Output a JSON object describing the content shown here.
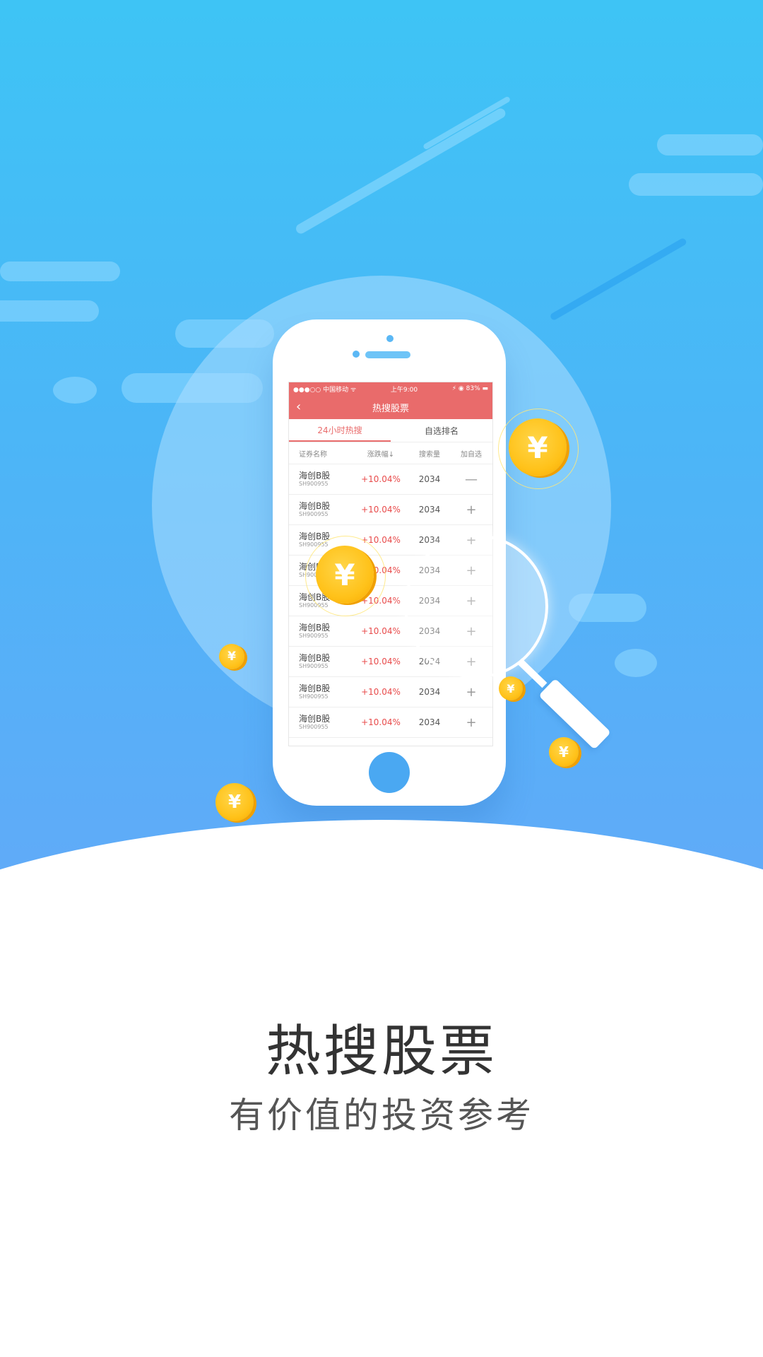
{
  "colors": {
    "accent": "#e96b6b",
    "hero_top": "#3ec4f5",
    "hero_bottom": "#63a9f8",
    "coin": "#ffc21a"
  },
  "phone": {
    "status_bar": {
      "carrier": "●●●○○ 中国移动 ᯤ",
      "time": "上午9:00",
      "battery": "⚡ ◉ 83% ▬"
    },
    "nav": {
      "back_icon": "‹",
      "title": "热搜股票"
    },
    "tabs": [
      {
        "label": "24小时热搜",
        "active": true
      },
      {
        "label": "自选排名",
        "active": false
      }
    ],
    "table": {
      "headers": [
        "证券名称",
        "涨跌幅↓",
        "搜索量",
        "加自选"
      ],
      "rows": [
        {
          "name": "海创B股",
          "code": "SH900955",
          "change": "+10.04%",
          "volume": "2034",
          "action": "—"
        },
        {
          "name": "海创B股",
          "code": "SH900955",
          "change": "+10.04%",
          "volume": "2034",
          "action": "+"
        },
        {
          "name": "海创B股",
          "code": "SH900955",
          "change": "+10.04%",
          "volume": "2034",
          "action": "+"
        },
        {
          "name": "海创B股",
          "code": "SH900955",
          "change": "+10.04%",
          "volume": "2034",
          "action": "+"
        },
        {
          "name": "海创B股",
          "code": "SH900955",
          "change": "+10.04%",
          "volume": "2034",
          "action": "+"
        },
        {
          "name": "海创B股",
          "code": "SH900955",
          "change": "+10.04%",
          "volume": "2034",
          "action": "+"
        },
        {
          "name": "海创B股",
          "code": "SH900955",
          "change": "+10.04%",
          "volume": "2034",
          "action": "+"
        },
        {
          "name": "海创B股",
          "code": "SH900955",
          "change": "+10.04%",
          "volume": "2034",
          "action": "+"
        },
        {
          "name": "海创B股",
          "code": "SH900955",
          "change": "+10.04%",
          "volume": "2034",
          "action": "+"
        }
      ]
    }
  },
  "coin_symbol": "¥",
  "headline": "热搜股票",
  "subheadline": "有价值的投资参考"
}
